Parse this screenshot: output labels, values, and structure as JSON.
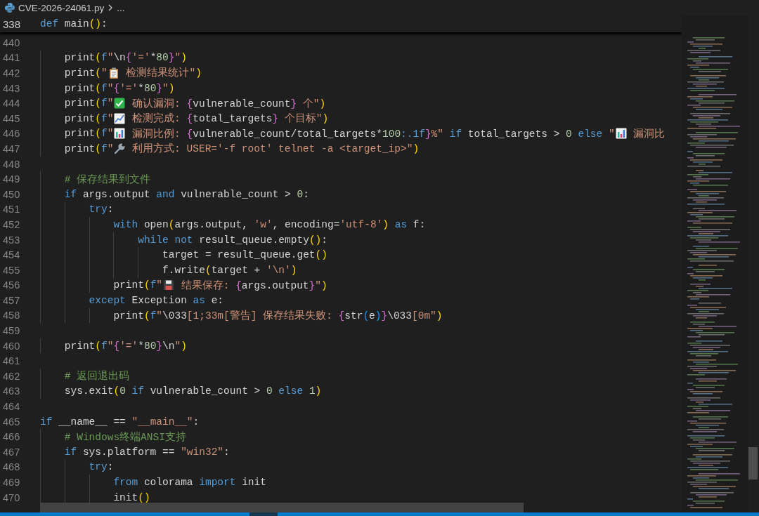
{
  "breadcrumb": {
    "file": "CVE-2026-24061.py",
    "more": "..."
  },
  "sticky": {
    "number": "338",
    "tokens": [
      {
        "kind": "kw",
        "text": "def"
      },
      {
        "kind": "plain",
        "text": " main"
      },
      {
        "kind": "p1",
        "text": "()"
      },
      {
        "kind": "plain",
        "text": ":"
      }
    ]
  },
  "lines": [
    {
      "number": "440"
    },
    {
      "number": "441",
      "tokens": [
        {
          "kind": "plain",
          "text": "    print"
        },
        {
          "kind": "p1",
          "text": "("
        },
        {
          "kind": "kw",
          "text": "f"
        },
        {
          "kind": "str",
          "text": "\""
        },
        {
          "kind": "plain",
          "text": "\\n"
        },
        {
          "kind": "p2",
          "text": "{"
        },
        {
          "kind": "str",
          "text": "'='"
        },
        {
          "kind": "plain",
          "text": "*"
        },
        {
          "kind": "num",
          "text": "80"
        },
        {
          "kind": "p2",
          "text": "}"
        },
        {
          "kind": "str",
          "text": "\""
        },
        {
          "kind": "p1",
          "text": ")"
        }
      ]
    },
    {
      "number": "442",
      "tokens": [
        {
          "kind": "plain",
          "text": "    print"
        },
        {
          "kind": "p1",
          "text": "("
        },
        {
          "kind": "str",
          "text": "\""
        },
        {
          "kind": "clipboard"
        },
        {
          "kind": "str",
          "text": " 检测结果统计\""
        },
        {
          "kind": "p1",
          "text": ")"
        }
      ]
    },
    {
      "number": "443",
      "tokens": [
        {
          "kind": "plain",
          "text": "    print"
        },
        {
          "kind": "p1",
          "text": "("
        },
        {
          "kind": "kw",
          "text": "f"
        },
        {
          "kind": "str",
          "text": "\""
        },
        {
          "kind": "p2",
          "text": "{"
        },
        {
          "kind": "str",
          "text": "'='"
        },
        {
          "kind": "plain",
          "text": "*"
        },
        {
          "kind": "num",
          "text": "80"
        },
        {
          "kind": "p2",
          "text": "}"
        },
        {
          "kind": "str",
          "text": "\""
        },
        {
          "kind": "p1",
          "text": ")"
        }
      ]
    },
    {
      "number": "444",
      "tokens": [
        {
          "kind": "plain",
          "text": "    print"
        },
        {
          "kind": "p1",
          "text": "("
        },
        {
          "kind": "kw",
          "text": "f"
        },
        {
          "kind": "str",
          "text": "\""
        },
        {
          "kind": "check"
        },
        {
          "kind": "str",
          "text": " 确认漏洞: "
        },
        {
          "kind": "p2",
          "text": "{"
        },
        {
          "kind": "plain",
          "text": "vulnerable_count"
        },
        {
          "kind": "p2",
          "text": "}"
        },
        {
          "kind": "str",
          "text": " 个\""
        },
        {
          "kind": "p1",
          "text": ")"
        }
      ]
    },
    {
      "number": "445",
      "tokens": [
        {
          "kind": "plain",
          "text": "    print"
        },
        {
          "kind": "p1",
          "text": "("
        },
        {
          "kind": "kw",
          "text": "f"
        },
        {
          "kind": "str",
          "text": "\""
        },
        {
          "kind": "chartup"
        },
        {
          "kind": "str",
          "text": " 检测完成: "
        },
        {
          "kind": "p2",
          "text": "{"
        },
        {
          "kind": "plain",
          "text": "total_targets"
        },
        {
          "kind": "p2",
          "text": "}"
        },
        {
          "kind": "str",
          "text": " 个目标\""
        },
        {
          "kind": "p1",
          "text": ")"
        }
      ]
    },
    {
      "number": "446",
      "tokens": [
        {
          "kind": "plain",
          "text": "    print"
        },
        {
          "kind": "p1",
          "text": "("
        },
        {
          "kind": "kw",
          "text": "f"
        },
        {
          "kind": "str",
          "text": "\""
        },
        {
          "kind": "chartbar"
        },
        {
          "kind": "str",
          "text": " 漏洞比例: "
        },
        {
          "kind": "p2",
          "text": "{"
        },
        {
          "kind": "plain",
          "text": "vulnerable_count/total_targets*"
        },
        {
          "kind": "num",
          "text": "100"
        },
        {
          "kind": "kw",
          "text": ":.1f"
        },
        {
          "kind": "p2",
          "text": "}"
        },
        {
          "kind": "str",
          "text": "%\""
        },
        {
          "kind": "kw",
          "text": " if"
        },
        {
          "kind": "plain",
          "text": " total_targets > "
        },
        {
          "kind": "num",
          "text": "0"
        },
        {
          "kind": "kw",
          "text": " else"
        },
        {
          "kind": "str",
          "text": " \""
        },
        {
          "kind": "chartbar"
        },
        {
          "kind": "str",
          "text": " 漏洞比"
        }
      ]
    },
    {
      "number": "447",
      "tokens": [
        {
          "kind": "plain",
          "text": "    print"
        },
        {
          "kind": "p1",
          "text": "("
        },
        {
          "kind": "kw",
          "text": "f"
        },
        {
          "kind": "str",
          "text": "\""
        },
        {
          "kind": "wrench"
        },
        {
          "kind": "str",
          "text": " 利用方式: USER='-f root' telnet -a <target_ip>\""
        },
        {
          "kind": "p1",
          "text": ")"
        }
      ]
    },
    {
      "number": "448"
    },
    {
      "number": "449",
      "tokens": [
        {
          "kind": "cmt",
          "text": "    # 保存结果到文件"
        }
      ]
    },
    {
      "number": "450",
      "tokens": [
        {
          "kind": "kw",
          "text": "    if"
        },
        {
          "kind": "plain",
          "text": " args.output "
        },
        {
          "kind": "kw",
          "text": "and"
        },
        {
          "kind": "plain",
          "text": " vulnerable_count > "
        },
        {
          "kind": "num",
          "text": "0"
        },
        {
          "kind": "plain",
          "text": ":"
        }
      ]
    },
    {
      "number": "451",
      "tokens": [
        {
          "kind": "kw",
          "text": "        try"
        },
        {
          "kind": "plain",
          "text": ":"
        }
      ]
    },
    {
      "number": "452",
      "tokens": [
        {
          "kind": "kw",
          "text": "            with"
        },
        {
          "kind": "plain",
          "text": " open"
        },
        {
          "kind": "p1",
          "text": "("
        },
        {
          "kind": "plain",
          "text": "args.output, "
        },
        {
          "kind": "str",
          "text": "'w'"
        },
        {
          "kind": "plain",
          "text": ", encoding="
        },
        {
          "kind": "str",
          "text": "'utf-8'"
        },
        {
          "kind": "p1",
          "text": ")"
        },
        {
          "kind": "kw",
          "text": " as"
        },
        {
          "kind": "plain",
          "text": " f:"
        }
      ]
    },
    {
      "number": "453",
      "tokens": [
        {
          "kind": "kw",
          "text": "                while not"
        },
        {
          "kind": "plain",
          "text": " result_queue.empty"
        },
        {
          "kind": "p1",
          "text": "()"
        },
        {
          "kind": "plain",
          "text": ":"
        }
      ]
    },
    {
      "number": "454",
      "tokens": [
        {
          "kind": "plain",
          "text": "                    target = result_queue.get"
        },
        {
          "kind": "p1",
          "text": "()"
        }
      ]
    },
    {
      "number": "455",
      "tokens": [
        {
          "kind": "plain",
          "text": "                    f.write"
        },
        {
          "kind": "p1",
          "text": "("
        },
        {
          "kind": "plain",
          "text": "target + "
        },
        {
          "kind": "str",
          "text": "'\\n'"
        },
        {
          "kind": "p1",
          "text": ")"
        }
      ]
    },
    {
      "number": "456",
      "tokens": [
        {
          "kind": "plain",
          "text": "            print"
        },
        {
          "kind": "p1",
          "text": "("
        },
        {
          "kind": "kw",
          "text": "f"
        },
        {
          "kind": "str",
          "text": "\""
        },
        {
          "kind": "floppy"
        },
        {
          "kind": "str",
          "text": " 结果保存: "
        },
        {
          "kind": "p2",
          "text": "{"
        },
        {
          "kind": "plain",
          "text": "args.output"
        },
        {
          "kind": "p2",
          "text": "}"
        },
        {
          "kind": "str",
          "text": "\""
        },
        {
          "kind": "p1",
          "text": ")"
        }
      ]
    },
    {
      "number": "457",
      "tokens": [
        {
          "kind": "kw",
          "text": "        except"
        },
        {
          "kind": "plain",
          "text": " Exception "
        },
        {
          "kind": "kw",
          "text": "as"
        },
        {
          "kind": "plain",
          "text": " e:"
        }
      ]
    },
    {
      "number": "458",
      "tokens": [
        {
          "kind": "plain",
          "text": "            print"
        },
        {
          "kind": "p1",
          "text": "("
        },
        {
          "kind": "kw",
          "text": "f"
        },
        {
          "kind": "str",
          "text": "\""
        },
        {
          "kind": "plain",
          "text": "\\033"
        },
        {
          "kind": "str",
          "text": "[1;33m[警告] 保存结果失败: "
        },
        {
          "kind": "p2",
          "text": "{"
        },
        {
          "kind": "plain",
          "text": "str"
        },
        {
          "kind": "p3",
          "text": "("
        },
        {
          "kind": "plain",
          "text": "e"
        },
        {
          "kind": "p3",
          "text": ")"
        },
        {
          "kind": "p2",
          "text": "}"
        },
        {
          "kind": "plain",
          "text": "\\033"
        },
        {
          "kind": "str",
          "text": "[0m\""
        },
        {
          "kind": "p1",
          "text": ")"
        }
      ]
    },
    {
      "number": "459"
    },
    {
      "number": "460",
      "tokens": [
        {
          "kind": "plain",
          "text": "    print"
        },
        {
          "kind": "p1",
          "text": "("
        },
        {
          "kind": "kw",
          "text": "f"
        },
        {
          "kind": "str",
          "text": "\""
        },
        {
          "kind": "p2",
          "text": "{"
        },
        {
          "kind": "str",
          "text": "'='"
        },
        {
          "kind": "plain",
          "text": "*"
        },
        {
          "kind": "num",
          "text": "80"
        },
        {
          "kind": "p2",
          "text": "}"
        },
        {
          "kind": "plain",
          "text": "\\n"
        },
        {
          "kind": "str",
          "text": "\""
        },
        {
          "kind": "p1",
          "text": ")"
        }
      ]
    },
    {
      "number": "461"
    },
    {
      "number": "462",
      "tokens": [
        {
          "kind": "cmt",
          "text": "    # 返回退出码"
        }
      ]
    },
    {
      "number": "463",
      "tokens": [
        {
          "kind": "plain",
          "text": "    sys.exit"
        },
        {
          "kind": "p1",
          "text": "("
        },
        {
          "kind": "num",
          "text": "0"
        },
        {
          "kind": "kw",
          "text": " if"
        },
        {
          "kind": "plain",
          "text": " vulnerable_count > "
        },
        {
          "kind": "num",
          "text": "0"
        },
        {
          "kind": "kw",
          "text": " else"
        },
        {
          "kind": "num",
          "text": " 1"
        },
        {
          "kind": "p1",
          "text": ")"
        }
      ]
    },
    {
      "number": "464"
    },
    {
      "number": "465",
      "tokens": [
        {
          "kind": "kw",
          "text": "if"
        },
        {
          "kind": "plain",
          "text": " __name__ == "
        },
        {
          "kind": "str",
          "text": "\"__main__\""
        },
        {
          "kind": "plain",
          "text": ":"
        }
      ]
    },
    {
      "number": "466",
      "tokens": [
        {
          "kind": "cmt",
          "text": "    # Windows终端ANSI支持"
        }
      ]
    },
    {
      "number": "467",
      "tokens": [
        {
          "kind": "kw",
          "text": "    if"
        },
        {
          "kind": "plain",
          "text": " sys.platform == "
        },
        {
          "kind": "str",
          "text": "\"win32\""
        },
        {
          "kind": "plain",
          "text": ":"
        }
      ]
    },
    {
      "number": "468",
      "tokens": [
        {
          "kind": "kw",
          "text": "        try"
        },
        {
          "kind": "plain",
          "text": ":"
        }
      ]
    },
    {
      "number": "469",
      "tokens": [
        {
          "kind": "kw",
          "text": "            from"
        },
        {
          "kind": "plain",
          "text": " colorama "
        },
        {
          "kind": "kw",
          "text": "import"
        },
        {
          "kind": "plain",
          "text": " init"
        }
      ]
    },
    {
      "number": "470",
      "tokens": [
        {
          "kind": "plain",
          "text": "            init"
        },
        {
          "kind": "p1",
          "text": "()"
        }
      ]
    }
  ]
}
